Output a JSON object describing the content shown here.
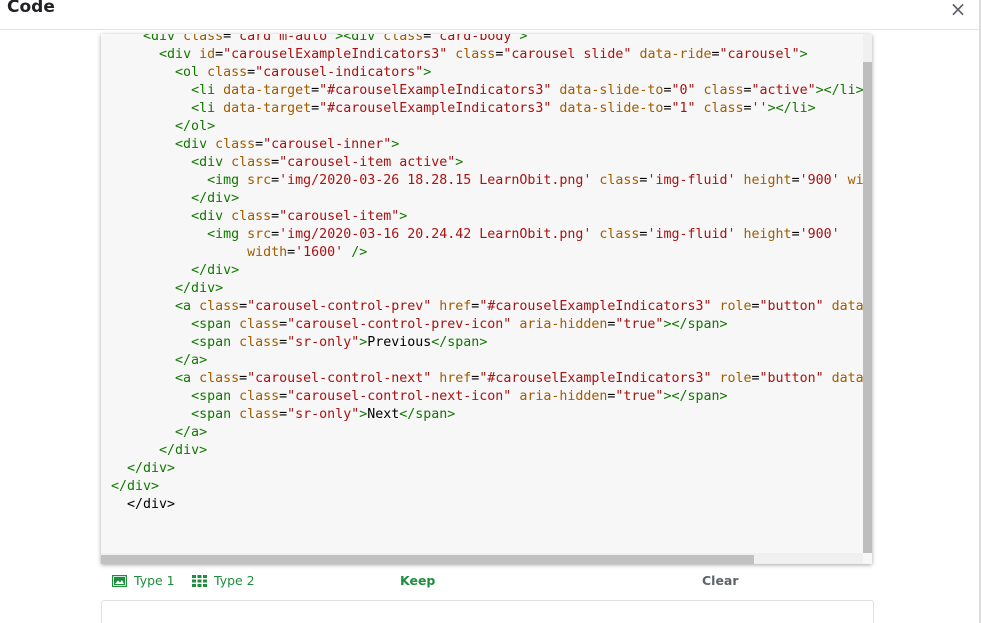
{
  "dialog": {
    "title": "Code",
    "close_symbol": "×"
  },
  "editor": {
    "lines": [
      {
        "indent": 4,
        "segs": [
          [
            "tag",
            "<div "
          ],
          [
            "attr",
            "class"
          ],
          [
            "txt",
            "="
          ],
          [
            "str",
            "'card m-auto'"
          ],
          [
            "tag",
            "><div "
          ],
          [
            "attr",
            "class"
          ],
          [
            "txt",
            "="
          ],
          [
            "str",
            "'card-body'"
          ],
          [
            "tag",
            ">"
          ]
        ]
      },
      {
        "indent": 6,
        "segs": [
          [
            "tag",
            "<div "
          ],
          [
            "attr",
            "id"
          ],
          [
            "txt",
            "="
          ],
          [
            "str",
            "\"carouselExampleIndicators3\""
          ],
          [
            "txt",
            " "
          ],
          [
            "attr",
            "class"
          ],
          [
            "txt",
            "="
          ],
          [
            "str",
            "\"carousel slide\""
          ],
          [
            "txt",
            " "
          ],
          [
            "attr",
            "data-ride"
          ],
          [
            "txt",
            "="
          ],
          [
            "str",
            "\"carousel\""
          ],
          [
            "tag",
            ">"
          ]
        ]
      },
      {
        "indent": 8,
        "segs": [
          [
            "tag",
            "<ol "
          ],
          [
            "attr",
            "class"
          ],
          [
            "txt",
            "="
          ],
          [
            "str",
            "\"carousel-indicators\""
          ],
          [
            "tag",
            ">"
          ]
        ]
      },
      {
        "indent": 10,
        "segs": [
          [
            "tag",
            "<li "
          ],
          [
            "attr",
            "data-target"
          ],
          [
            "txt",
            "="
          ],
          [
            "str",
            "\"#carouselExampleIndicators3\""
          ],
          [
            "txt",
            " "
          ],
          [
            "attr",
            "data-slide-to"
          ],
          [
            "txt",
            "="
          ],
          [
            "str",
            "\"0\""
          ],
          [
            "txt",
            " "
          ],
          [
            "attr",
            "class"
          ],
          [
            "txt",
            "="
          ],
          [
            "str",
            "\"active\""
          ],
          [
            "tag",
            "></li>"
          ]
        ]
      },
      {
        "indent": 10,
        "segs": [
          [
            "tag",
            "<li "
          ],
          [
            "attr",
            "data-target"
          ],
          [
            "txt",
            "="
          ],
          [
            "str",
            "\"#carouselExampleIndicators3\""
          ],
          [
            "txt",
            " "
          ],
          [
            "attr",
            "data-slide-to"
          ],
          [
            "txt",
            "="
          ],
          [
            "str",
            "\"1\""
          ],
          [
            "txt",
            " "
          ],
          [
            "attr",
            "class"
          ],
          [
            "txt",
            "="
          ],
          [
            "str",
            "''"
          ],
          [
            "tag",
            "></li>"
          ]
        ]
      },
      {
        "indent": 8,
        "segs": [
          [
            "tag",
            "</ol>"
          ]
        ]
      },
      {
        "indent": 8,
        "segs": [
          [
            "tag",
            "<div "
          ],
          [
            "attr",
            "class"
          ],
          [
            "txt",
            "="
          ],
          [
            "str",
            "\"carousel-inner\""
          ],
          [
            "tag",
            ">"
          ]
        ]
      },
      {
        "indent": 10,
        "segs": [
          [
            "tag",
            "<div "
          ],
          [
            "attr",
            "class"
          ],
          [
            "txt",
            "="
          ],
          [
            "str",
            "\"carousel-item active\""
          ],
          [
            "tag",
            ">"
          ]
        ]
      },
      {
        "indent": 12,
        "segs": [
          [
            "tag",
            "<img "
          ],
          [
            "attr",
            "src"
          ],
          [
            "txt",
            "="
          ],
          [
            "str",
            "'img/2020-03-26 18.28.15 LearnObit.png'"
          ],
          [
            "txt",
            " "
          ],
          [
            "attr",
            "class"
          ],
          [
            "txt",
            "="
          ],
          [
            "str",
            "'img-fluid'"
          ],
          [
            "txt",
            " "
          ],
          [
            "attr",
            "height"
          ],
          [
            "txt",
            "="
          ],
          [
            "str",
            "'900'"
          ],
          [
            "txt",
            " "
          ],
          [
            "attr",
            "width"
          ]
        ]
      },
      {
        "indent": 10,
        "segs": [
          [
            "tag",
            "</div>"
          ]
        ]
      },
      {
        "indent": 10,
        "segs": [
          [
            "tag",
            "<div "
          ],
          [
            "attr",
            "class"
          ],
          [
            "txt",
            "="
          ],
          [
            "str",
            "\"carousel-item\""
          ],
          [
            "tag",
            ">"
          ]
        ]
      },
      {
        "indent": 12,
        "segs": [
          [
            "tag",
            "<img "
          ],
          [
            "attr",
            "src"
          ],
          [
            "txt",
            "="
          ],
          [
            "str",
            "'img/2020-03-16 20.24.42 LearnObit.png'"
          ],
          [
            "txt",
            " "
          ],
          [
            "attr",
            "class"
          ],
          [
            "txt",
            "="
          ],
          [
            "str",
            "'img-fluid'"
          ],
          [
            "txt",
            " "
          ],
          [
            "attr",
            "height"
          ],
          [
            "txt",
            "="
          ],
          [
            "str",
            "'900'"
          ]
        ]
      },
      {
        "indent": 17,
        "segs": [
          [
            "attr",
            "width"
          ],
          [
            "txt",
            "="
          ],
          [
            "str",
            "'1600'"
          ],
          [
            "txt",
            " "
          ],
          [
            "tag",
            "/>"
          ]
        ]
      },
      {
        "indent": 10,
        "segs": [
          [
            "tag",
            "</div>"
          ]
        ]
      },
      {
        "indent": 8,
        "segs": [
          [
            "tag",
            "</div>"
          ]
        ]
      },
      {
        "indent": 8,
        "segs": [
          [
            "tag",
            "<a "
          ],
          [
            "attr",
            "class"
          ],
          [
            "txt",
            "="
          ],
          [
            "str",
            "\"carousel-control-prev\""
          ],
          [
            "txt",
            " "
          ],
          [
            "attr",
            "href"
          ],
          [
            "txt",
            "="
          ],
          [
            "str",
            "\"#carouselExampleIndicators3\""
          ],
          [
            "txt",
            " "
          ],
          [
            "attr",
            "role"
          ],
          [
            "txt",
            "="
          ],
          [
            "str",
            "\"button\""
          ],
          [
            "txt",
            " "
          ],
          [
            "attr",
            "data-slide"
          ]
        ]
      },
      {
        "indent": 10,
        "segs": [
          [
            "tag",
            "<span "
          ],
          [
            "attr",
            "class"
          ],
          [
            "txt",
            "="
          ],
          [
            "str",
            "\"carousel-control-prev-icon\""
          ],
          [
            "txt",
            " "
          ],
          [
            "attr",
            "aria-hidden"
          ],
          [
            "txt",
            "="
          ],
          [
            "str",
            "\"true\""
          ],
          [
            "tag",
            "></span>"
          ]
        ]
      },
      {
        "indent": 10,
        "segs": [
          [
            "tag",
            "<span "
          ],
          [
            "attr",
            "class"
          ],
          [
            "txt",
            "="
          ],
          [
            "str",
            "\"sr-only\""
          ],
          [
            "tag",
            ">"
          ],
          [
            "txt",
            "Previous"
          ],
          [
            "tag",
            "</span>"
          ]
        ]
      },
      {
        "indent": 8,
        "segs": [
          [
            "tag",
            "</a>"
          ]
        ]
      },
      {
        "indent": 8,
        "segs": [
          [
            "tag",
            "<a "
          ],
          [
            "attr",
            "class"
          ],
          [
            "txt",
            "="
          ],
          [
            "str",
            "\"carousel-control-next\""
          ],
          [
            "txt",
            " "
          ],
          [
            "attr",
            "href"
          ],
          [
            "txt",
            "="
          ],
          [
            "str",
            "\"#carouselExampleIndicators3\""
          ],
          [
            "txt",
            " "
          ],
          [
            "attr",
            "role"
          ],
          [
            "txt",
            "="
          ],
          [
            "str",
            "\"button\""
          ],
          [
            "txt",
            " "
          ],
          [
            "attr",
            "data-slide"
          ]
        ]
      },
      {
        "indent": 10,
        "segs": [
          [
            "tag",
            "<span "
          ],
          [
            "attr",
            "class"
          ],
          [
            "txt",
            "="
          ],
          [
            "str",
            "\"carousel-control-next-icon\""
          ],
          [
            "txt",
            " "
          ],
          [
            "attr",
            "aria-hidden"
          ],
          [
            "txt",
            "="
          ],
          [
            "str",
            "\"true\""
          ],
          [
            "tag",
            "></span>"
          ]
        ]
      },
      {
        "indent": 10,
        "segs": [
          [
            "tag",
            "<span "
          ],
          [
            "attr",
            "class"
          ],
          [
            "txt",
            "="
          ],
          [
            "str",
            "\"sr-only\""
          ],
          [
            "tag",
            ">"
          ],
          [
            "txt",
            "Next"
          ],
          [
            "tag",
            "</span>"
          ]
        ]
      },
      {
        "indent": 8,
        "segs": [
          [
            "tag",
            "</a>"
          ]
        ]
      },
      {
        "indent": 6,
        "segs": [
          [
            "tag",
            "</div>"
          ]
        ]
      },
      {
        "indent": 2,
        "segs": [
          [
            "tag",
            "</div>"
          ]
        ]
      },
      {
        "indent": 0,
        "segs": [
          [
            "tag",
            "</div>"
          ]
        ]
      },
      {
        "indent": 2,
        "segs": [
          [
            "txt",
            "</div>"
          ]
        ]
      }
    ]
  },
  "toolbar": {
    "type1_label": "Type 1",
    "type2_label": "Type 2",
    "keep_label": "Keep",
    "clear_label": "Clear",
    "type1_icon": "image-icon",
    "type2_icon": "grid-icon"
  },
  "colors": {
    "accent_green": "#1e8e3e",
    "tag": "#117700",
    "attr": "#a15c00",
    "string": "#aa1111"
  }
}
